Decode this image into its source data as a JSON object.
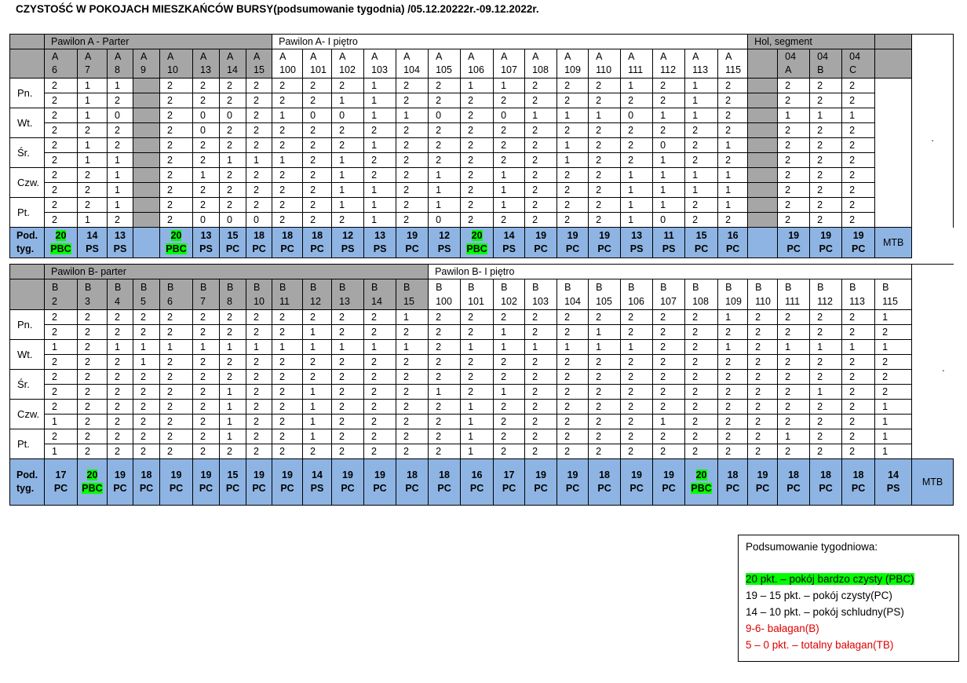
{
  "title": "CZYSTOŚĆ W POKOJACH MIESZKAŃCÓW BURSY(podsumowanie tygodnia) /05.12.20222r.-09.12.2022r.",
  "tableA": {
    "sections": {
      "parter": "Pawilon A - Parter",
      "pietro": "Pawilon A- I piętro",
      "hol": "Hol, segment"
    },
    "rooms": [
      [
        "A",
        "6"
      ],
      [
        "A",
        "7"
      ],
      [
        "A",
        "8"
      ],
      [
        "A",
        "9"
      ],
      [
        "A",
        "10"
      ],
      [
        "A",
        "13"
      ],
      [
        "A",
        "14"
      ],
      [
        "A",
        "15"
      ],
      [
        "A",
        "100"
      ],
      [
        "A",
        "101"
      ],
      [
        "A",
        "102"
      ],
      [
        "A",
        "103"
      ],
      [
        "A",
        "104"
      ],
      [
        "A",
        "105"
      ],
      [
        "A",
        "106"
      ],
      [
        "A",
        "107"
      ],
      [
        "A",
        "108"
      ],
      [
        "A",
        "109"
      ],
      [
        "A",
        "110"
      ],
      [
        "A",
        "111"
      ],
      [
        "A",
        "112"
      ],
      [
        "A",
        "113"
      ],
      [
        "A",
        "115"
      ],
      [
        "",
        ""
      ],
      [
        "04",
        "A"
      ],
      [
        "04",
        "B"
      ],
      [
        "04",
        "C"
      ],
      [
        "",
        ""
      ]
    ],
    "days": [
      "Pn.",
      "Wt.",
      "Śr.",
      "Czw.",
      "Pt."
    ],
    "rows": [
      [
        "2",
        "1",
        "1",
        "",
        "2",
        "2",
        "2",
        "2",
        "2",
        "2",
        "2",
        "1",
        "2",
        "2",
        "1",
        "1",
        "2",
        "2",
        "2",
        "1",
        "2",
        "1",
        "2",
        "",
        "2",
        "2",
        "2",
        ""
      ],
      [
        "2",
        "1",
        "2",
        "",
        "2",
        "2",
        "2",
        "2",
        "2",
        "2",
        "1",
        "1",
        "2",
        "2",
        "2",
        "2",
        "2",
        "2",
        "2",
        "2",
        "2",
        "1",
        "2",
        "",
        "2",
        "2",
        "2",
        ""
      ],
      [
        "2",
        "1",
        "0",
        "",
        "2",
        "0",
        "0",
        "2",
        "1",
        "0",
        "0",
        "1",
        "1",
        "0",
        "2",
        "0",
        "1",
        "1",
        "1",
        "0",
        "1",
        "1",
        "2",
        "",
        "1",
        "1",
        "1",
        ""
      ],
      [
        "2",
        "2",
        "2",
        "",
        "2",
        "0",
        "2",
        "2",
        "2",
        "2",
        "2",
        "2",
        "2",
        "2",
        "2",
        "2",
        "2",
        "2",
        "2",
        "2",
        "2",
        "2",
        "2",
        "",
        "2",
        "2",
        "2",
        ""
      ],
      [
        "2",
        "1",
        "2",
        "",
        "2",
        "2",
        "2",
        "2",
        "2",
        "2",
        "2",
        "1",
        "2",
        "2",
        "2",
        "2",
        "2",
        "1",
        "2",
        "2",
        "0",
        "2",
        "1",
        "",
        "2",
        "2",
        "2",
        ""
      ],
      [
        "2",
        "1",
        "1",
        "",
        "2",
        "2",
        "1",
        "1",
        "1",
        "2",
        "1",
        "2",
        "2",
        "2",
        "2",
        "2",
        "2",
        "1",
        "2",
        "2",
        "1",
        "2",
        "2",
        "",
        "2",
        "2",
        "2",
        ""
      ],
      [
        "2",
        "2",
        "1",
        "",
        "2",
        "1",
        "2",
        "2",
        "2",
        "2",
        "1",
        "2",
        "2",
        "1",
        "2",
        "1",
        "2",
        "2",
        "2",
        "1",
        "1",
        "1",
        "1",
        "",
        "2",
        "2",
        "2",
        ""
      ],
      [
        "2",
        "2",
        "1",
        "",
        "2",
        "2",
        "2",
        "2",
        "2",
        "2",
        "1",
        "1",
        "2",
        "1",
        "2",
        "1",
        "2",
        "2",
        "2",
        "1",
        "1",
        "1",
        "1",
        "",
        "2",
        "2",
        "2",
        ""
      ],
      [
        "2",
        "2",
        "1",
        "",
        "2",
        "2",
        "2",
        "2",
        "2",
        "2",
        "1",
        "1",
        "2",
        "1",
        "2",
        "1",
        "2",
        "2",
        "2",
        "1",
        "1",
        "2",
        "1",
        "",
        "2",
        "2",
        "2",
        ""
      ],
      [
        "2",
        "1",
        "2",
        "",
        "2",
        "0",
        "0",
        "0",
        "2",
        "2",
        "2",
        "1",
        "2",
        "0",
        "2",
        "2",
        "2",
        "2",
        "2",
        "1",
        "0",
        "2",
        "2",
        "",
        "2",
        "2",
        "2",
        ""
      ]
    ],
    "pod_label": [
      "Pod.",
      "tyg."
    ],
    "pod": [
      [
        "20",
        "PBC"
      ],
      [
        "14",
        "PS"
      ],
      [
        "13",
        "PS"
      ],
      [
        "",
        ""
      ],
      [
        "20",
        "PBC"
      ],
      [
        "13",
        "PS"
      ],
      [
        "15",
        "PC"
      ],
      [
        "18",
        "PC"
      ],
      [
        "18",
        "PC"
      ],
      [
        "18",
        "PC"
      ],
      [
        "12",
        "PS"
      ],
      [
        "13",
        "PS"
      ],
      [
        "19",
        "PC"
      ],
      [
        "12",
        "PS"
      ],
      [
        "20",
        "PBC"
      ],
      [
        "14",
        "PS"
      ],
      [
        "19",
        "PC"
      ],
      [
        "19",
        "PC"
      ],
      [
        "19",
        "PC"
      ],
      [
        "13",
        "PS"
      ],
      [
        "11",
        "PS"
      ],
      [
        "15",
        "PC"
      ],
      [
        "16",
        "PC"
      ],
      [
        "",
        ""
      ],
      [
        "19",
        "PC"
      ],
      [
        "19",
        "PC"
      ],
      [
        "19",
        "PC"
      ],
      [
        "",
        ""
      ]
    ],
    "mtb": "MTB",
    "dot": "."
  },
  "tableB": {
    "sections": {
      "parter": "Pawilon B- parter",
      "pietro": "Pawilon B- I piętro"
    },
    "rooms": [
      [
        "B",
        "2"
      ],
      [
        "B",
        "3"
      ],
      [
        "B",
        "4"
      ],
      [
        "B",
        "5"
      ],
      [
        "B",
        "6"
      ],
      [
        "B",
        "7"
      ],
      [
        "B",
        "8"
      ],
      [
        "B",
        "10"
      ],
      [
        "B",
        "11"
      ],
      [
        "B",
        "12"
      ],
      [
        "B",
        "13"
      ],
      [
        "B",
        "14"
      ],
      [
        "B",
        "15"
      ],
      [
        "B",
        "100"
      ],
      [
        "B",
        "101"
      ],
      [
        "B",
        "102"
      ],
      [
        "B",
        "103"
      ],
      [
        "B",
        "104"
      ],
      [
        "B",
        "105"
      ],
      [
        "B",
        "106"
      ],
      [
        "B",
        "107"
      ],
      [
        "B",
        "108"
      ],
      [
        "B",
        "109"
      ],
      [
        "B",
        "110"
      ],
      [
        "B",
        "111"
      ],
      [
        "B",
        "112"
      ],
      [
        "B",
        "113"
      ],
      [
        "B",
        "115"
      ]
    ],
    "days": [
      "Pn.",
      "Wt.",
      "Śr.",
      "Czw.",
      "Pt."
    ],
    "rows": [
      [
        "2",
        "2",
        "2",
        "2",
        "2",
        "2",
        "2",
        "2",
        "2",
        "2",
        "2",
        "2",
        "1",
        "2",
        "2",
        "2",
        "2",
        "2",
        "2",
        "2",
        "2",
        "2",
        "1",
        "2",
        "2",
        "2",
        "2",
        "1"
      ],
      [
        "2",
        "2",
        "2",
        "2",
        "2",
        "2",
        "2",
        "2",
        "2",
        "1",
        "2",
        "2",
        "2",
        "2",
        "2",
        "1",
        "2",
        "2",
        "1",
        "2",
        "2",
        "2",
        "2",
        "2",
        "2",
        "2",
        "2",
        "2"
      ],
      [
        "1",
        "2",
        "1",
        "1",
        "1",
        "1",
        "1",
        "1",
        "1",
        "1",
        "1",
        "1",
        "1",
        "2",
        "1",
        "1",
        "1",
        "1",
        "1",
        "1",
        "2",
        "2",
        "1",
        "2",
        "1",
        "1",
        "1",
        "1"
      ],
      [
        "2",
        "2",
        "2",
        "1",
        "2",
        "2",
        "2",
        "2",
        "2",
        "2",
        "2",
        "2",
        "2",
        "2",
        "2",
        "2",
        "2",
        "2",
        "2",
        "2",
        "2",
        "2",
        "2",
        "2",
        "2",
        "2",
        "2",
        "2"
      ],
      [
        "2",
        "2",
        "2",
        "2",
        "2",
        "2",
        "2",
        "2",
        "2",
        "2",
        "2",
        "2",
        "2",
        "2",
        "2",
        "2",
        "2",
        "2",
        "2",
        "2",
        "2",
        "2",
        "2",
        "2",
        "2",
        "2",
        "2",
        "2"
      ],
      [
        "2",
        "2",
        "2",
        "2",
        "2",
        "2",
        "1",
        "2",
        "2",
        "1",
        "2",
        "2",
        "2",
        "1",
        "2",
        "1",
        "2",
        "2",
        "2",
        "2",
        "2",
        "2",
        "2",
        "2",
        "2",
        "1",
        "2",
        "2"
      ],
      [
        "2",
        "2",
        "2",
        "2",
        "2",
        "2",
        "1",
        "2",
        "2",
        "1",
        "2",
        "2",
        "2",
        "2",
        "1",
        "2",
        "2",
        "2",
        "2",
        "2",
        "2",
        "2",
        "2",
        "2",
        "2",
        "2",
        "2",
        "1"
      ],
      [
        "1",
        "2",
        "2",
        "2",
        "2",
        "2",
        "1",
        "2",
        "2",
        "1",
        "2",
        "2",
        "2",
        "2",
        "1",
        "2",
        "2",
        "2",
        "2",
        "2",
        "1",
        "2",
        "2",
        "2",
        "2",
        "2",
        "2",
        "1"
      ],
      [
        "2",
        "2",
        "2",
        "2",
        "2",
        "2",
        "1",
        "2",
        "2",
        "1",
        "2",
        "2",
        "2",
        "2",
        "1",
        "2",
        "2",
        "2",
        "2",
        "2",
        "2",
        "2",
        "2",
        "2",
        "1",
        "2",
        "2",
        "1"
      ],
      [
        "1",
        "2",
        "2",
        "2",
        "2",
        "2",
        "2",
        "2",
        "2",
        "2",
        "2",
        "2",
        "2",
        "2",
        "1",
        "2",
        "2",
        "2",
        "2",
        "2",
        "2",
        "2",
        "2",
        "2",
        "2",
        "2",
        "2",
        "1"
      ]
    ],
    "pod_label": [
      "Pod.",
      "tyg."
    ],
    "pod": [
      [
        "17",
        "PC"
      ],
      [
        "20",
        "PBC"
      ],
      [
        "19",
        "PC"
      ],
      [
        "18",
        "PC"
      ],
      [
        "19",
        "PC"
      ],
      [
        "19",
        "PC"
      ],
      [
        "15",
        "PC"
      ],
      [
        "19",
        "PC"
      ],
      [
        "19",
        "PC"
      ],
      [
        "14",
        "PS"
      ],
      [
        "19",
        "PC"
      ],
      [
        "19",
        "PC"
      ],
      [
        "18",
        "PC"
      ],
      [
        "18",
        "PC"
      ],
      [
        "16",
        "PC"
      ],
      [
        "17",
        "PC"
      ],
      [
        "19",
        "PC"
      ],
      [
        "19",
        "PC"
      ],
      [
        "18",
        "PC"
      ],
      [
        "19",
        "PC"
      ],
      [
        "19",
        "PC"
      ],
      [
        "20",
        "PBC"
      ],
      [
        "18",
        "PC"
      ],
      [
        "19",
        "PC"
      ],
      [
        "18",
        "PC"
      ],
      [
        "18",
        "PC"
      ],
      [
        "18",
        "PC"
      ],
      [
        "14",
        "PS"
      ]
    ],
    "mtb": "MTB",
    "dot": "."
  },
  "legend": {
    "title": "Podsumowanie tygodniowa:",
    "pbc": "20 pkt. – pokój bardzo czysty (PBC)",
    "pc": "19 – 15 pkt. – pokój czysty(PC)",
    "ps": "14 – 10 pkt. – pokój schludny(PS)",
    "b": "9-6- bałagan(B)",
    "tb": "5 – 0 pkt. – totalny bałagan(TB)"
  }
}
